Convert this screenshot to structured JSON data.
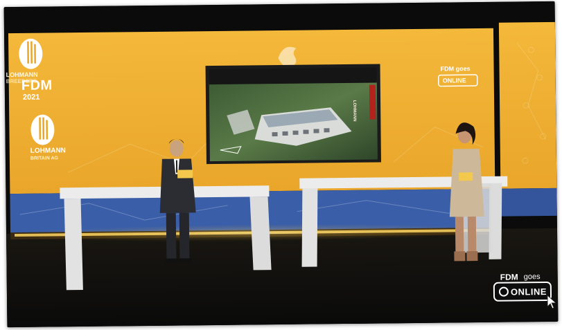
{
  "left_panel": {
    "brand_line1": "LOHMANN",
    "brand_line2": "BREEDERS",
    "event": "FDM",
    "year": "2021",
    "brand_line3": "LOHMANN",
    "brand_line4": "BRITAIN AG"
  },
  "screen_badge": {
    "line1": "FDM goes",
    "line2": "ONLINE"
  },
  "video_screen": {
    "side_sign": "LOHMANN"
  },
  "watermark": {
    "prefix": "FDM",
    "suffix": "goes",
    "online": "ONLINE"
  },
  "colors": {
    "led_wall": "#f2b335",
    "floor": "#0f0f0f",
    "desk": "#ececec",
    "footer_blue": "#3a5ea8"
  }
}
